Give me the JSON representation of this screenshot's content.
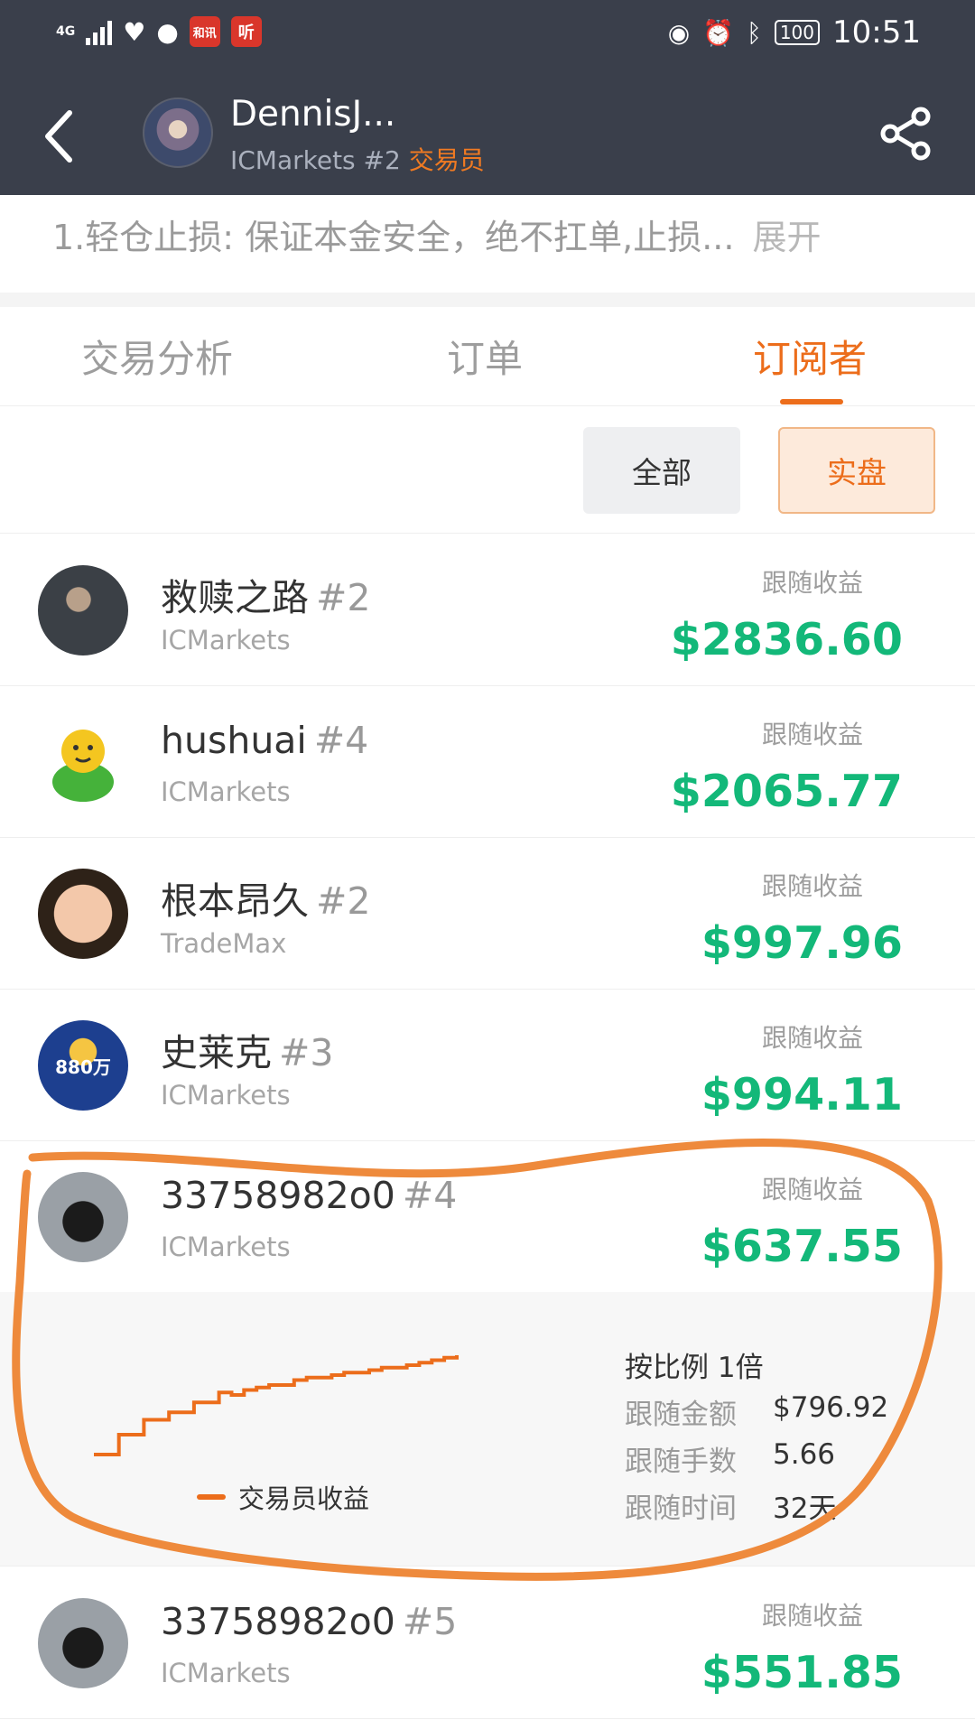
{
  "status_bar": {
    "network": "4G",
    "app_badges": [
      "和讯",
      "听"
    ],
    "battery": "100",
    "time": "10:51"
  },
  "header": {
    "title": "DennisJ...",
    "broker_rank": "ICMarkets #2",
    "role": "交易员"
  },
  "intro": {
    "text": "1.轻仓止损: 保证本金安全，绝不扛单,止损...",
    "expand_label": "展开"
  },
  "tabs": [
    {
      "label": "交易分析",
      "active": false
    },
    {
      "label": "订单",
      "active": false
    },
    {
      "label": "订阅者",
      "active": true
    }
  ],
  "filters": {
    "all_label": "全部",
    "real_label": "实盘"
  },
  "subscribers": [
    {
      "name": "救赎之路",
      "rank": "#2",
      "broker": "ICMarkets",
      "profit_label": "跟随收益",
      "profit": "$2836.60"
    },
    {
      "name": "hushuai",
      "rank": "#4",
      "broker": "ICMarkets",
      "profit_label": "跟随收益",
      "profit": "$2065.77"
    },
    {
      "name": "根本昂久",
      "rank": "#2",
      "broker": "TradeMax",
      "profit_label": "跟随收益",
      "profit": "$997.96"
    },
    {
      "name": "史莱克",
      "rank": "#3",
      "broker": "ICMarkets",
      "profit_label": "跟随收益",
      "profit": "$994.11",
      "avatar_text": "880万"
    },
    {
      "name": "33758982o0",
      "rank": "#4",
      "broker": "ICMarkets",
      "profit_label": "跟随收益",
      "profit": "$637.55"
    },
    {
      "name": "33758982o0",
      "rank": "#5",
      "broker": "ICMarkets",
      "profit_label": "跟随收益",
      "profit": "$551.85"
    }
  ],
  "detail": {
    "legend": "交易员收益",
    "ratio": "按比例 1倍",
    "stats": [
      {
        "label": "跟随金额",
        "value": "$796.92"
      },
      {
        "label": "跟随手数",
        "value": "5.66"
      },
      {
        "label": "跟随时间",
        "value": "32天"
      }
    ],
    "chart_points": [
      0,
      0,
      8,
      8,
      14,
      14,
      17,
      17,
      21,
      21,
      25,
      24,
      26,
      27,
      28,
      28,
      30,
      31,
      31,
      32,
      33,
      33,
      34,
      35,
      35,
      36,
      37,
      38,
      39,
      40
    ]
  },
  "colors": {
    "header_bg": "#3a3f4b",
    "accent": "#ec6d1b",
    "profit_green": "#13b879"
  }
}
